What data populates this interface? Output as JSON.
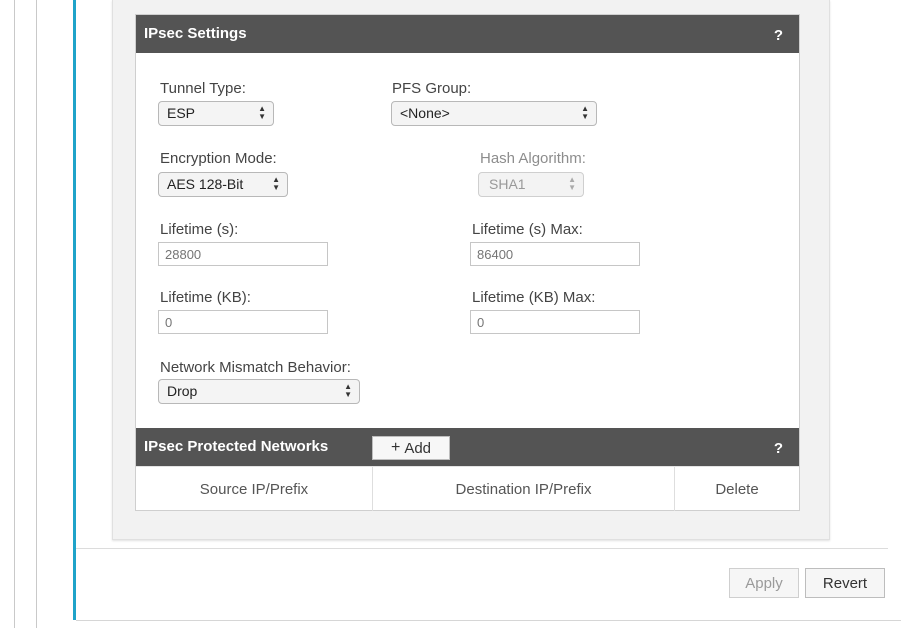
{
  "ipsec_settings": {
    "title": "IPsec Settings",
    "help": "?",
    "tunnel_type": {
      "label": "Tunnel Type:",
      "value": "ESP"
    },
    "pfs_group": {
      "label": "PFS Group:",
      "value": "<None>"
    },
    "encryption_mode": {
      "label": "Encryption Mode:",
      "value": "AES 128-Bit"
    },
    "hash_algorithm": {
      "label": "Hash Algorithm:",
      "value": "SHA1",
      "disabled": true
    },
    "lifetime_s": {
      "label": "Lifetime (s):",
      "placeholder": "28800"
    },
    "lifetime_s_max": {
      "label": "Lifetime (s) Max:",
      "placeholder": "86400"
    },
    "lifetime_kb": {
      "label": "Lifetime (KB):",
      "placeholder": "0"
    },
    "lifetime_kb_max": {
      "label": "Lifetime (KB) Max:",
      "placeholder": "0"
    },
    "network_mismatch": {
      "label": "Network Mismatch Behavior:",
      "value": "Drop"
    }
  },
  "protected_networks": {
    "title": "IPsec Protected Networks",
    "add_label": "Add",
    "help": "?",
    "columns": [
      "Source IP/Prefix",
      "Destination IP/Prefix",
      "Delete"
    ]
  },
  "footer": {
    "apply_label": "Apply",
    "revert_label": "Revert",
    "apply_disabled": true
  },
  "colors": {
    "accent": "#1fa3c9",
    "header_bar": "#545454"
  },
  "icons": {
    "select_arrows": "updown-arrows-icon",
    "add": "plus-icon"
  }
}
